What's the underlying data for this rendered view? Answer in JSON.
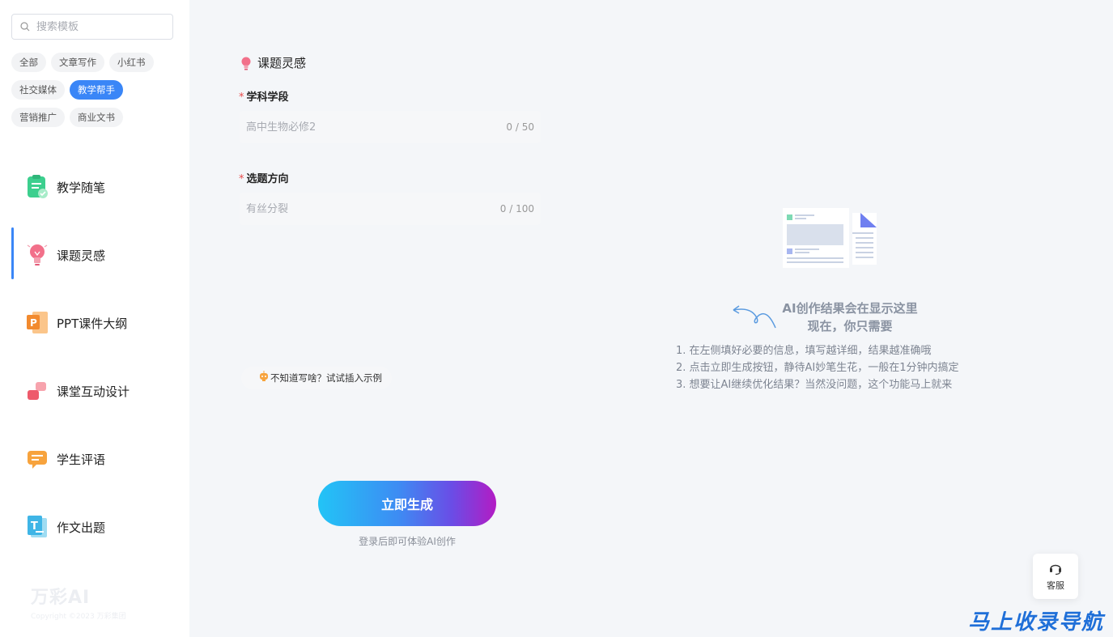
{
  "search": {
    "placeholder": "搜索模板"
  },
  "tags": [
    [
      "全部",
      "文章写作",
      "小红书"
    ],
    [
      "社交媒体",
      "教学帮手"
    ],
    [
      "营销推广",
      "商业文书"
    ]
  ],
  "active_tag": "教学帮手",
  "menu": [
    {
      "label": "教学随笔",
      "icon": "notepad-check-icon"
    },
    {
      "label": "课题灵感",
      "icon": "lightbulb-icon",
      "active": true
    },
    {
      "label": "PPT课件大纲",
      "icon": "ppt-icon"
    },
    {
      "label": "课堂互动设计",
      "icon": "interaction-icon"
    },
    {
      "label": "学生评语",
      "icon": "comment-icon"
    },
    {
      "label": "作文出题",
      "icon": "essay-icon"
    }
  ],
  "brand": {
    "logo": "万彩AI",
    "copyright": "Copyright ©2023 万彩集团"
  },
  "form": {
    "title": "课题灵感",
    "fields": [
      {
        "label": "学科学段",
        "placeholder": "高中生物必修2",
        "count": "0 / 50"
      },
      {
        "label": "选题方向",
        "placeholder": "有丝分裂",
        "count": "0 / 100"
      }
    ],
    "hint": "不知道写啥？试试插入示例",
    "generate_label": "立即生成",
    "generate_sub": "登录后即可体验AI创作"
  },
  "result": {
    "title_line1": "AI创作结果会在显示这里",
    "title_line2": "现在，你只需要",
    "steps": [
      "1. 在左侧填好必要的信息，填写越详细，结果越准确哦",
      "2. 点击立即生成按钮，静待AI妙笔生花，一般在1分钟内搞定",
      "3. 想要让AI继续优化结果？当然没问题，这个功能马上就来"
    ]
  },
  "service": {
    "label": "客服"
  },
  "watermark": "马上收录导航",
  "colors": {
    "accent": "#3a86f7",
    "required": "#e84a4a"
  }
}
